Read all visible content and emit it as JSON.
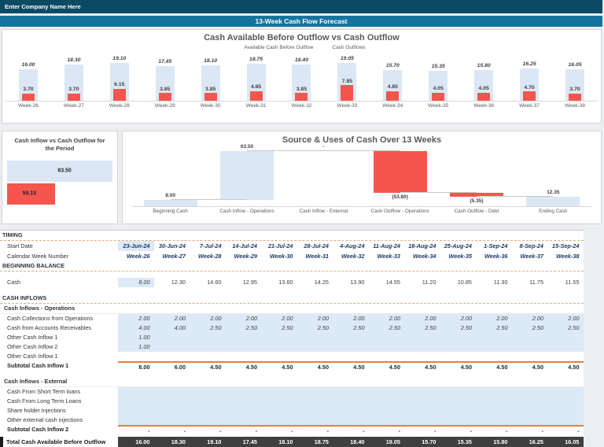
{
  "header": {
    "company_name": "Enter Company Name Here",
    "forecast_title": "13-Week Cash Flow Forecast"
  },
  "weeks": [
    "Week-26",
    "Week-27",
    "Week-28",
    "Week-29",
    "Week-30",
    "Week-31",
    "Week-32",
    "Week-33",
    "Week-34",
    "Week-35",
    "Week-36",
    "Week-37",
    "Week-38"
  ],
  "colors": {
    "navy_bar": "#0C4A63",
    "teal_bar": "#15749C",
    "light_blue": "#DBE7F4",
    "red": "#F4564E",
    "orange_accent": "#ED7D31",
    "input_cell_blue": "#DCE9F7",
    "total_row_dark": "#3F3F3F"
  },
  "chart_data": [
    {
      "type": "bar",
      "title": "Cash Available Before Outflow vs Cash Outflow",
      "legend_position": "top",
      "ylim": [
        0,
        20
      ],
      "categories": [
        "Week-26",
        "Week-27",
        "Week-28",
        "Week-29",
        "Week-30",
        "Week-31",
        "Week-32",
        "Week-33",
        "Week-34",
        "Week-35",
        "Week-36",
        "Week-37",
        "Week-38"
      ],
      "series": [
        {
          "name": "Available Cash Before Outflow",
          "color": "#DBE7F4",
          "values": [
            16.0,
            18.3,
            19.1,
            17.45,
            18.1,
            18.75,
            18.4,
            19.05,
            15.7,
            15.35,
            15.8,
            16.25,
            16.05
          ]
        },
        {
          "name": "Cash Outflows",
          "color": "#F4564E",
          "values": [
            3.7,
            3.7,
            6.15,
            3.85,
            3.85,
            4.85,
            3.85,
            7.85,
            4.85,
            4.05,
            4.05,
            4.7,
            3.7
          ]
        }
      ]
    },
    {
      "type": "bar",
      "orientation": "horizontal",
      "title": "Cash Inflow vs Cash Outflow for the Period",
      "categories": [
        "Cash Inflow",
        "Cash Outflow"
      ],
      "values": [
        63.5,
        59.15
      ],
      "colors": [
        "#DBE7F4",
        "#F4564E"
      ]
    },
    {
      "type": "bar",
      "variant": "waterfall",
      "title": "Source & Uses of Cash Over 13 Weeks",
      "categories": [
        "Beginning Cash",
        "Cash Inflow - Operations",
        "Cash Inflow - External",
        "Cash Outflow - Operations",
        "Cash Outflow - Debt",
        "Ending Cash"
      ],
      "values": [
        8.0,
        63.5,
        0,
        -53.8,
        -5.35,
        12.35
      ],
      "labels": [
        "8.00",
        "63.50",
        "-",
        "(53.80)",
        "(5.35)",
        "12.35"
      ],
      "bar_kinds": [
        "total",
        "increase",
        "increase",
        "decrease",
        "decrease",
        "total"
      ],
      "colors": {
        "increase": "#DBE7F4",
        "decrease": "#F4564E",
        "total": "#DBE7F4"
      }
    }
  ],
  "table": {
    "rows": [
      {
        "type": "header",
        "label": "TIMING",
        "first": true
      },
      {
        "type": "dates",
        "label": "Start Date",
        "highlight_first": true,
        "values": [
          "23-Jun-24",
          "30-Jun-24",
          "7-Jul-24",
          "14-Jul-24",
          "21-Jul-24",
          "28-Jul-24",
          "4-Aug-24",
          "11-Aug-24",
          "18-Aug-24",
          "25-Aug-24",
          "1-Sep-24",
          "8-Sep-24",
          "15-Sep-24"
        ]
      },
      {
        "type": "dates",
        "label": "Calendar Week Number",
        "values": [
          "Week-26",
          "Week-27",
          "Week-28",
          "Week-29",
          "Week-30",
          "Week-31",
          "Week-32",
          "Week-33",
          "Week-34",
          "Week-35",
          "Week-36",
          "Week-37",
          "Week-38"
        ]
      },
      {
        "type": "header",
        "label": "BEGINNING BALANCE"
      },
      {
        "type": "spacer"
      },
      {
        "type": "data",
        "label": "Cash",
        "highlight_first": true,
        "values": [
          "8.00",
          "12.30",
          "14.60",
          "12.95",
          "13.60",
          "14.25",
          "13.90",
          "14.55",
          "11.20",
          "10.85",
          "11.30",
          "11.75",
          "11.55"
        ]
      },
      {
        "type": "spacer"
      },
      {
        "type": "header",
        "label": "CASH INFLOWS"
      },
      {
        "type": "subheader",
        "label": "Cash Inflows - Operations"
      },
      {
        "type": "input",
        "label": "Cash Collections from Operations",
        "values": [
          "2.00",
          "2.00",
          "2.00",
          "2.00",
          "2.00",
          "2.00",
          "2.00",
          "2.00",
          "2.00",
          "2.00",
          "2.00",
          "2.00",
          "2.00"
        ]
      },
      {
        "type": "input",
        "label": "Cash from Accounts Receivables",
        "values": [
          "4.00",
          "4.00",
          "2.50",
          "2.50",
          "2.50",
          "2.50",
          "2.50",
          "2.50",
          "2.50",
          "2.50",
          "2.50",
          "2.50",
          "2.50"
        ]
      },
      {
        "type": "input",
        "label": "Other Cash Inflow 1",
        "values": [
          "1.00",
          "",
          "",
          "",
          "",
          "",
          "",
          "",
          "",
          "",
          "",
          "",
          ""
        ]
      },
      {
        "type": "input",
        "label": "Other Cash Inflow 2",
        "values": [
          "1.00",
          "",
          "",
          "",
          "",
          "",
          "",
          "",
          "",
          "",
          "",
          "",
          ""
        ]
      },
      {
        "type": "data",
        "label": "Other Cash Inflow 1",
        "values": [
          "",
          "",
          "",
          "",
          "",
          "",
          "",
          "",
          "",
          "",
          "",
          "",
          ""
        ]
      },
      {
        "type": "subtotal",
        "label": "Subtotal Cash Inflow 1",
        "values": [
          "8.00",
          "6.00",
          "4.50",
          "4.50",
          "4.50",
          "4.50",
          "4.50",
          "4.50",
          "4.50",
          "4.50",
          "4.50",
          "4.50",
          "4.50"
        ]
      },
      {
        "type": "spacer"
      },
      {
        "type": "subheader",
        "label": "Cash Inflows - External"
      },
      {
        "type": "input",
        "label": "Cash From Short Term loans",
        "values": [
          "",
          "",
          "",
          "",
          "",
          "",
          "",
          "",
          "",
          "",
          "",
          "",
          ""
        ]
      },
      {
        "type": "input",
        "label": "Cash From Long Term Loans",
        "values": [
          "",
          "",
          "",
          "",
          "",
          "",
          "",
          "",
          "",
          "",
          "",
          "",
          ""
        ]
      },
      {
        "type": "input",
        "label": "Share holder Injections",
        "values": [
          "",
          "",
          "",
          "",
          "",
          "",
          "",
          "",
          "",
          "",
          "",
          "",
          ""
        ]
      },
      {
        "type": "input",
        "label": "Other external cash injections",
        "values": [
          "",
          "",
          "",
          "",
          "",
          "",
          "",
          "",
          "",
          "",
          "",
          "",
          ""
        ]
      },
      {
        "type": "subtotal",
        "label": "Subtotal Cash Inflow  2",
        "values": [
          "-",
          "-",
          "-",
          "-",
          "-",
          "-",
          "-",
          "-",
          "-",
          "-",
          "-",
          "-",
          "-"
        ]
      },
      {
        "type": "gap"
      },
      {
        "type": "total",
        "label": "Total Cash Available Before Outflow",
        "values": [
          "16.00",
          "18.30",
          "19.10",
          "17.45",
          "18.10",
          "18.75",
          "18.40",
          "19.05",
          "15.70",
          "15.35",
          "15.80",
          "16.25",
          "16.05"
        ]
      }
    ]
  }
}
